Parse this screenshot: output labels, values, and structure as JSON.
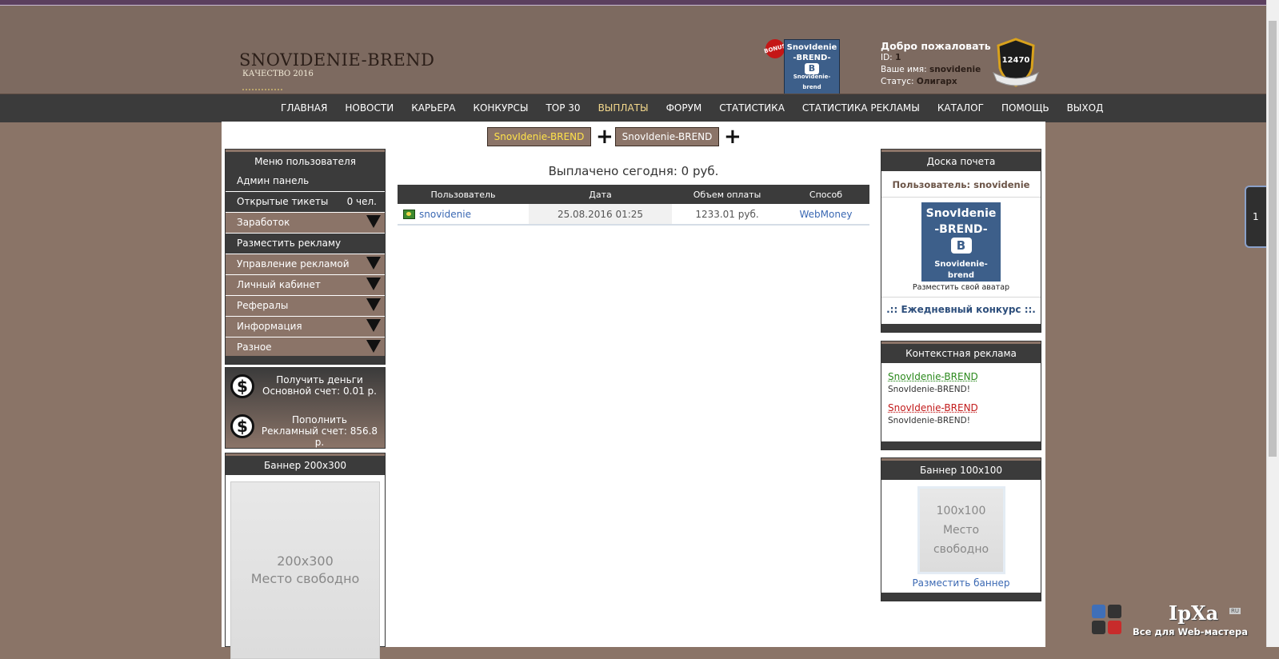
{
  "header": {
    "logo_title": "SNOVIDENIE-BREND",
    "logo_subtitle": "КАЧЕСТВО 2016",
    "bonus_badge": "BONUS",
    "avatar_line1": "SnovIdenie",
    "avatar_line2": "-BREND-",
    "avatar_letter": "B",
    "avatar_footer": "Snovidenie-brend",
    "welcome": "Добро пожаловать",
    "id_label": "ID:",
    "id_value": "1",
    "name_label": "Ваше имя:",
    "name_value": "snovidenie",
    "status_label": "Статус:",
    "status_value": "Олигарх",
    "rank_number": "12470"
  },
  "nav": {
    "items": [
      "ГЛАВНАЯ",
      "НОВОСТИ",
      "КАРЬЕРА",
      "КОНКУРСЫ",
      "TOP 30",
      "ВЫПЛАТЫ",
      "ФОРУМ",
      "СТАТИСТИКА",
      "СТАТИСТИКА РЕКЛАМЫ",
      "КАТАЛОГ",
      "ПОМОЩЬ",
      "ВЫХОД"
    ],
    "active": "ВЫПЛАТЫ",
    "active_color": "#f3d88c"
  },
  "tabs": {
    "left": "SnovIdenie-BREND",
    "right": "SnovIdenie-BREND",
    "plus": "+"
  },
  "user_menu": {
    "title": "Меню пользователя",
    "items": {
      "admin": "Админ панель",
      "tickets": "Открытые тикеты",
      "tickets_count": "0 чел.",
      "earnings": "Заработок",
      "place_ad": "Разместить рекламу",
      "manage_ads": "Управление рекламой",
      "cabinet": "Личный кабинет",
      "referrals": "Рефералы",
      "info": "Информация",
      "misc": "Разное"
    }
  },
  "money": {
    "get_money": "Получить деньги",
    "main_account": "Основной счет: 0.01 р.",
    "top_up": "Пополнить",
    "ad_account": "Рекламный счет: 856.8 р.",
    "icon_glyph": "$"
  },
  "banner_left": {
    "title": "Баннер 200x300",
    "placeholder_size": "200x300",
    "placeholder_text": "Место свободно"
  },
  "payouts": {
    "title": "Выплачено сегодня: 0 руб.",
    "columns": [
      "Пользователь",
      "Дата",
      "Объем оплаты",
      "Способ"
    ],
    "rows": [
      {
        "user": "snovidenie",
        "date": "25.08.2016 01:25",
        "amount": "1233.01 руб.",
        "method": "WebMoney"
      }
    ]
  },
  "honor_board": {
    "title": "Доска почета",
    "user_line": "Пользователь: snovidenie",
    "avatar_line1": "SnovIdenie",
    "avatar_line2": "-BREND-",
    "avatar_letter": "B",
    "avatar_footer": "Snovidenie-brend",
    "avatar_caption": "Разместить свой аватар",
    "contest": ".:: Ежедневный конкурс ::."
  },
  "context_ads": {
    "title": "Контекстная реклама",
    "ads": [
      {
        "title": "SnovIdenie-BREND",
        "desc": "SnovIdenie-BREND!",
        "color": "#2c8a1e"
      },
      {
        "title": "SnovIdenie-BREND",
        "desc": "SnovIdenie-BREND!",
        "color": "#c21b1b"
      }
    ]
  },
  "banner_right": {
    "title": "Баннер 100x100",
    "placeholder_size": "100x100",
    "placeholder_line2": "Место",
    "placeholder_line3": "свободно",
    "link": "Разместить баннер"
  },
  "side_tab": {
    "label": "1"
  },
  "watermark": {
    "brand": "IpXa",
    "ru": "RU",
    "tagline": "Все для Web-мастера"
  },
  "colors": {
    "brand_brown": "#8b7468",
    "dark_bar": "#3b3b3b",
    "link_blue": "#3a68b3"
  }
}
